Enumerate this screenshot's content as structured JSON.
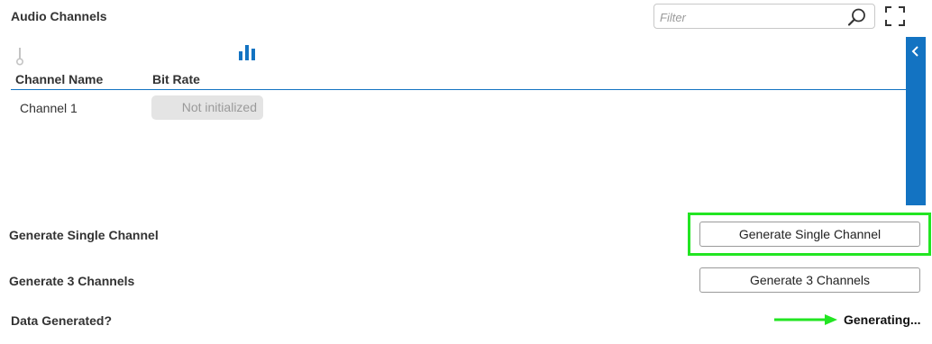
{
  "panel": {
    "title": "Audio Channels"
  },
  "filter": {
    "placeholder": "Filter",
    "value": ""
  },
  "icons": {
    "search": "search-icon",
    "fullscreen": "fullscreen-icon",
    "collapse": "chevron-left-icon",
    "pin": "pin-icon",
    "bitrate": "bar-chart-icon"
  },
  "table": {
    "columns": [
      "Channel Name",
      "Bit Rate"
    ],
    "rows": [
      {
        "name": "Channel 1",
        "bit_rate": "Not initialized"
      }
    ]
  },
  "actions": {
    "single": {
      "label": "Generate Single Channel",
      "button": "Generate Single Channel"
    },
    "three": {
      "label": "Generate 3 Channels",
      "button": "Generate 3 Channels"
    }
  },
  "status": {
    "label": "Data Generated?",
    "value": "Generating..."
  },
  "colors": {
    "accent": "#1373c2",
    "highlight": "#22e522",
    "badge_bg": "#e4e4e4"
  }
}
